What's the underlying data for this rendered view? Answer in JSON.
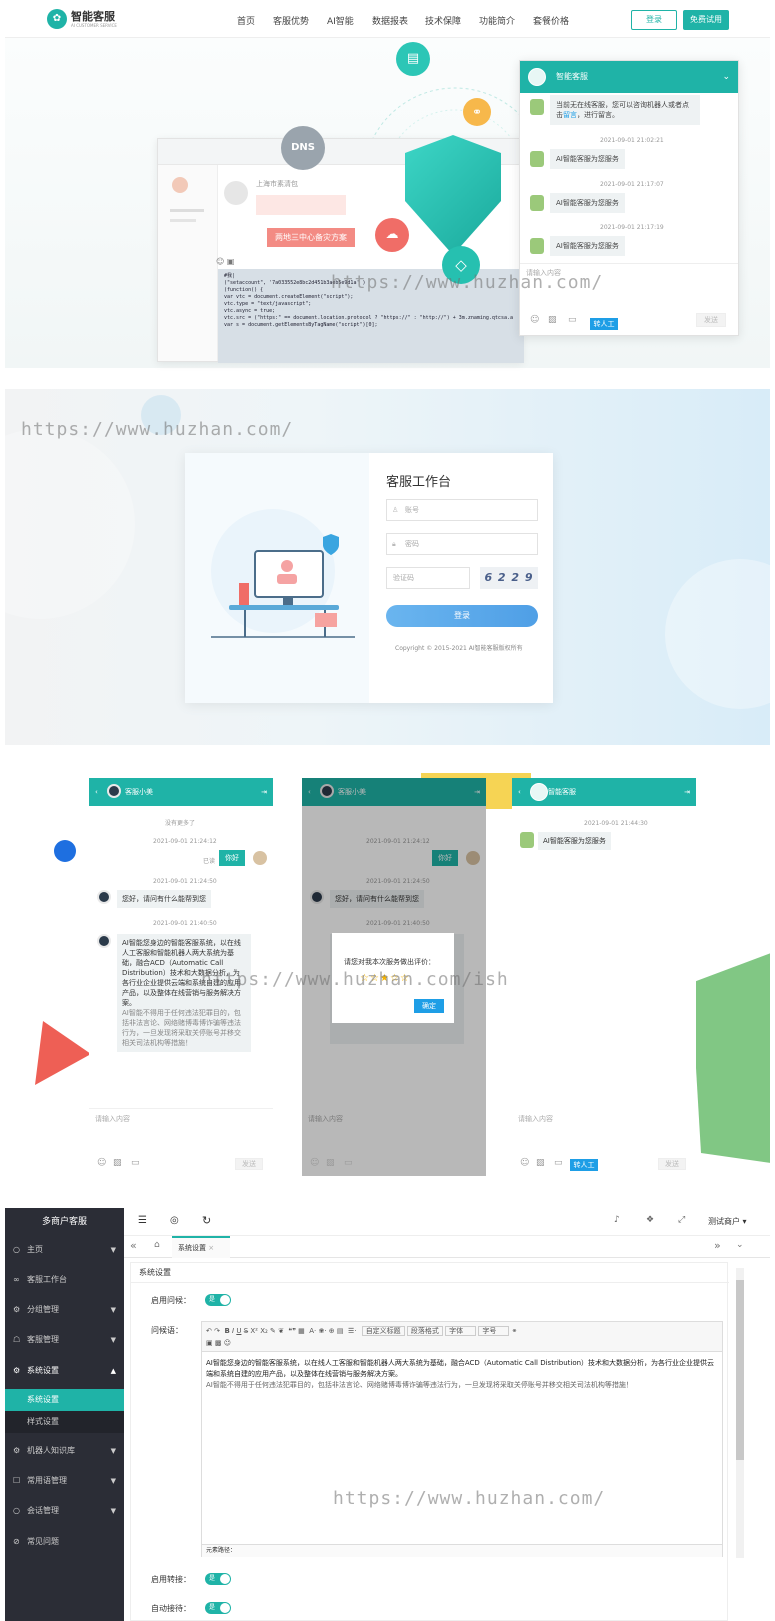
{
  "site": {
    "logo_title": "智能客服",
    "logo_sub": "AI CUSTOMER SERVICE",
    "nav": [
      "首页",
      "客服优势",
      "AI智能",
      "数据报表",
      "技术保障",
      "功能简介",
      "套餐价格"
    ],
    "login_btn": "登录",
    "trial_btn": "免费试用"
  },
  "hero": {
    "dns_label": "DNS",
    "red_tag": "两地三中心备灾方案",
    "mock_name": "上海市素清包",
    "code_lines": [
      "#我|",
      "  (\"setaccount\", '7a033552e8bc2d451b3aeb5e9d1a' )",
      "  (function() {",
      "    var vtc = document.createElement(\"script\");",
      "    vtc.type = \"text/javascript\";",
      "    vtc.async = true;",
      "    vtc.src = (\"https:\" == document.location.protocol ? \"https://\" : \"http://\") + 3m.znaming.qtcsa.a",
      "    var s = document.getElementsByTagName(\"script\")[0];"
    ],
    "chat": {
      "title": "智能客服",
      "offline_pre": "当前无在线客服，您可以咨询机器人或者点击",
      "offline_link": "留言",
      "offline_post": "，进行留言。",
      "messages": [
        {
          "time": "2021-09-01 21:02:21",
          "text": "AI智能客服为您服务"
        },
        {
          "time": "2021-09-01 21:17:07",
          "text": "AI智能客服为您服务"
        },
        {
          "time": "2021-09-01 21:17:19",
          "text": "AI智能客服为您服务"
        }
      ],
      "input_placeholder": "请输入内容",
      "transfer_btn": "转人工",
      "send_btn": "发送"
    }
  },
  "login": {
    "title": "客服工作台",
    "account_placeholder": "账号",
    "password_placeholder": "密码",
    "captcha_placeholder": "验证码",
    "captcha_code": "6 2 2 9",
    "submit": "登录",
    "copyright": "Copyright © 2015-2021 AI智能客服版权所有"
  },
  "mobile": {
    "agent_name": "客服小美",
    "bot_name": "智能客服",
    "no_more": "没有更多了",
    "t1": "2021-09-01 21:24:12",
    "t2": "2021-09-01 21:24:50",
    "t3": "2021-09-01 21:40:50",
    "t4": "2021-09-01 21:44:30",
    "user_msg": "你好",
    "user_read": "已读",
    "greet": "您好，请问有什么能帮到您",
    "intro": "AI智能您身边的智能客服系统，以在线人工客服和智能机器人两大系统为基础，融合ACD（Automatic Call Distribution）技术和大数据分析，为各行业企业提供云端和系统自建的应用产品，以及整体在线营销与服务解决方案。",
    "warn": "AI智能不得用于任何违法犯罪目的，包括非法言论、网络赌博毒博诈骗等违法行为，一旦发现将采取关停账号并移交相关司法机构等措施！",
    "bot_msg": "AI智能客服为您服务",
    "input_placeholder": "请输入内容",
    "send": "发送",
    "transfer": "转人工",
    "rate_prompt": "请您对我本次服务做出评价：",
    "confirm": "确定"
  },
  "admin": {
    "brand": "多商户客服",
    "menu": [
      {
        "label": "主页",
        "icon": "○",
        "arrow": "▼"
      },
      {
        "label": "客服工作台",
        "icon": "∞",
        "arrow": ""
      },
      {
        "label": "分组管理",
        "icon": "⚙",
        "arrow": "▼"
      },
      {
        "label": "客服管理",
        "icon": "☖",
        "arrow": "▼"
      },
      {
        "label": "系统设置",
        "icon": "⚙",
        "arrow": "▲"
      },
      {
        "label": "系统设置",
        "icon": "",
        "arrow": ""
      },
      {
        "label": "样式设置",
        "icon": "",
        "arrow": ""
      },
      {
        "label": "机器人知识库",
        "icon": "⚙",
        "arrow": "▼"
      },
      {
        "label": "常用语管理",
        "icon": "☐",
        "arrow": "▼"
      },
      {
        "label": "会话管理",
        "icon": "○",
        "arrow": "▼"
      },
      {
        "label": "常见问题",
        "icon": "⊘",
        "arrow": ""
      }
    ],
    "user": "测试商户",
    "tab": "系统设置",
    "section": "系统设置",
    "label_enable": "启用问候：",
    "label_greet": "问候语：",
    "label_transfer": "启用转接：",
    "label_auto": "自动接待：",
    "toggle_on": "是",
    "toolbar_custom": "自定义标题",
    "toolbar_para": "段落格式",
    "toolbar_font": "字体",
    "toolbar_size": "字号",
    "editor_text1": "AI智能您身边的智能客服系统，以在线人工客服和智能机器人两大系统为基础，融合ACD（Automatic Call Distribution）技术和大数据分析，为各行业企业提供云端和系统自建的应用产品，以及整体在线营销与服务解决方案。",
    "editor_text2": "AI智能不得用于任何违法犯罪目的，包括非法言论、网络赌博毒博诈骗等违法行为，一旦发现将采取关停账号并移交相关司法机构等措施！",
    "element_path": "元素路径："
  },
  "watermark": "https://www.huzhan.com/",
  "watermark3": "https://www.huzhan.com/ish",
  "colors": {
    "accent": "#1fb3a7",
    "blue": "#1e9ee6"
  }
}
